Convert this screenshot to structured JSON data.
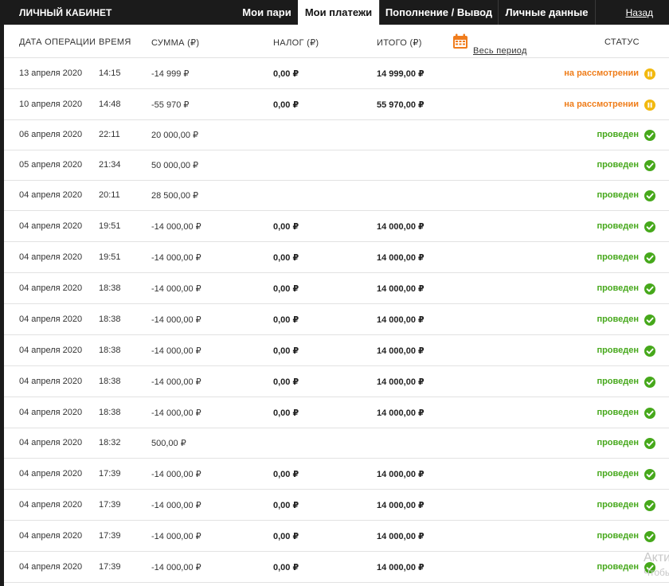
{
  "topbar": {
    "title": "ЛИЧНЫЙ КАБИНЕТ",
    "tabs": [
      {
        "label": "Мои пари",
        "active": false
      },
      {
        "label": "Мои платежи",
        "active": true
      },
      {
        "label": "Пополнение / Вывод",
        "active": false
      },
      {
        "label": "Личные данные",
        "active": false
      }
    ],
    "back_label": "Назад"
  },
  "table": {
    "headers": {
      "date": "ДАТА ОПЕРАЦИИ",
      "time": "ВРЕМЯ",
      "amount": "СУММА (₽)",
      "tax": "НАЛОГ (₽)",
      "total": "ИТОГО (₽)",
      "period": "Весь период",
      "status": "СТАТУС"
    },
    "rows": [
      {
        "date": "13 апреля 2020",
        "time": "14:15",
        "amount": "-14 999 ₽",
        "tax": "0,00 ₽",
        "total": "14 999,00 ₽",
        "status": "на рассмотрении",
        "status_type": "pending"
      },
      {
        "date": "10 апреля 2020",
        "time": "14:48",
        "amount": "-55 970 ₽",
        "tax": "0,00 ₽",
        "total": "55 970,00 ₽",
        "status": "на рассмотрении",
        "status_type": "pending"
      },
      {
        "date": "06 апреля 2020",
        "time": "22:11",
        "amount": "20 000,00 ₽",
        "tax": "",
        "total": "",
        "status": "проведен",
        "status_type": "ok"
      },
      {
        "date": "05 апреля 2020",
        "time": "21:34",
        "amount": "50 000,00 ₽",
        "tax": "",
        "total": "",
        "status": "проведен",
        "status_type": "ok"
      },
      {
        "date": "04 апреля 2020",
        "time": "20:11",
        "amount": "28 500,00 ₽",
        "tax": "",
        "total": "",
        "status": "проведен",
        "status_type": "ok"
      },
      {
        "date": "04 апреля 2020",
        "time": "19:51",
        "amount": "-14 000,00 ₽",
        "tax": "0,00 ₽",
        "total": "14 000,00 ₽",
        "status": "проведен",
        "status_type": "ok"
      },
      {
        "date": "04 апреля 2020",
        "time": "19:51",
        "amount": "-14 000,00 ₽",
        "tax": "0,00 ₽",
        "total": "14 000,00 ₽",
        "status": "проведен",
        "status_type": "ok"
      },
      {
        "date": "04 апреля 2020",
        "time": "18:38",
        "amount": "-14 000,00 ₽",
        "tax": "0,00 ₽",
        "total": "14 000,00 ₽",
        "status": "проведен",
        "status_type": "ok"
      },
      {
        "date": "04 апреля 2020",
        "time": "18:38",
        "amount": "-14 000,00 ₽",
        "tax": "0,00 ₽",
        "total": "14 000,00 ₽",
        "status": "проведен",
        "status_type": "ok"
      },
      {
        "date": "04 апреля 2020",
        "time": "18:38",
        "amount": "-14 000,00 ₽",
        "tax": "0,00 ₽",
        "total": "14 000,00 ₽",
        "status": "проведен",
        "status_type": "ok"
      },
      {
        "date": "04 апреля 2020",
        "time": "18:38",
        "amount": "-14 000,00 ₽",
        "tax": "0,00 ₽",
        "total": "14 000,00 ₽",
        "status": "проведен",
        "status_type": "ok"
      },
      {
        "date": "04 апреля 2020",
        "time": "18:38",
        "amount": "-14 000,00 ₽",
        "tax": "0,00 ₽",
        "total": "14 000,00 ₽",
        "status": "проведен",
        "status_type": "ok"
      },
      {
        "date": "04 апреля 2020",
        "time": "18:32",
        "amount": "500,00 ₽",
        "tax": "",
        "total": "",
        "status": "проведен",
        "status_type": "ok"
      },
      {
        "date": "04 апреля 2020",
        "time": "17:39",
        "amount": "-14 000,00 ₽",
        "tax": "0,00 ₽",
        "total": "14 000,00 ₽",
        "status": "проведен",
        "status_type": "ok"
      },
      {
        "date": "04 апреля 2020",
        "time": "17:39",
        "amount": "-14 000,00 ₽",
        "tax": "0,00 ₽",
        "total": "14 000,00 ₽",
        "status": "проведен",
        "status_type": "ok"
      },
      {
        "date": "04 апреля 2020",
        "time": "17:39",
        "amount": "-14 000,00 ₽",
        "tax": "0,00 ₽",
        "total": "14 000,00 ₽",
        "status": "проведен",
        "status_type": "ok"
      },
      {
        "date": "04 апреля 2020",
        "time": "17:39",
        "amount": "-14 000,00 ₽",
        "tax": "0,00 ₽",
        "total": "14 000,00 ₽",
        "status": "проведен",
        "status_type": "ok"
      }
    ]
  },
  "icons": {
    "period": "calendar-icon",
    "ok": "check-circle-icon",
    "pending": "pause-circle-icon"
  },
  "colors": {
    "ok": "#46a81b",
    "pending": "#ef7d1a",
    "pending_icon": "#f2b90f",
    "calendar": "#f07c1c",
    "topbar": "#1b1b1b"
  },
  "watermark": {
    "line1": "Акти",
    "line2": "Чтобы"
  }
}
